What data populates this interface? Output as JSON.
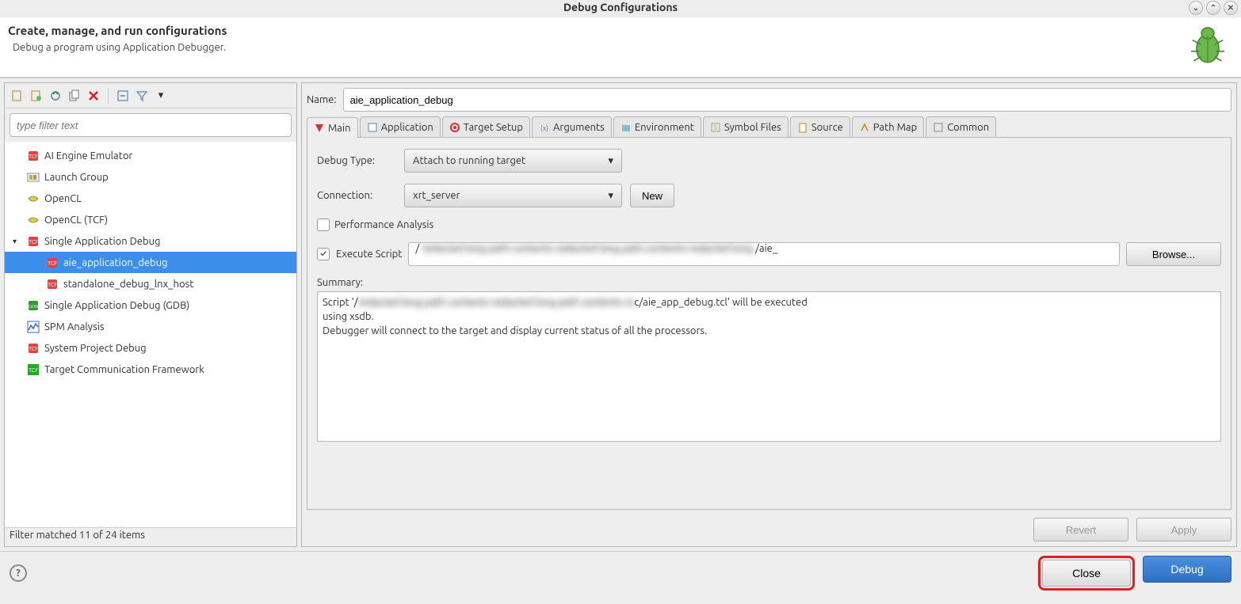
{
  "window": {
    "title": "Debug Configurations"
  },
  "header": {
    "title": "Create, manage, and run configurations",
    "subtitle": "Debug a program using Application Debugger."
  },
  "left": {
    "filter_placeholder": "type filter text",
    "status": "Filter matched 11 of 24 items",
    "tree": [
      {
        "label": "AI Engine Emulator",
        "icon": "tcf-icon"
      },
      {
        "label": "Launch Group",
        "icon": "launch-group-icon"
      },
      {
        "label": "OpenCL",
        "icon": "opencl-icon"
      },
      {
        "label": "OpenCL (TCF)",
        "icon": "opencl-icon"
      },
      {
        "label": "Single Application Debug",
        "icon": "tcf-icon",
        "expanded": true,
        "children": [
          {
            "label": "aie_application_debug",
            "icon": "tcf-icon",
            "selected": true
          },
          {
            "label": "standalone_debug_lnx_host",
            "icon": "tcf-icon"
          }
        ]
      },
      {
        "label": "Single Application Debug (GDB)",
        "icon": "gdb-icon"
      },
      {
        "label": "SPM Analysis",
        "icon": "spm-icon"
      },
      {
        "label": "System Project Debug",
        "icon": "tcf-icon"
      },
      {
        "label": "Target Communication Framework",
        "icon": "tcf-green-icon"
      }
    ]
  },
  "right": {
    "name_label": "Name:",
    "name_value": "aie_application_debug",
    "tabs": [
      {
        "label": "Main",
        "active": true
      },
      {
        "label": "Application"
      },
      {
        "label": "Target Setup"
      },
      {
        "label": "Arguments"
      },
      {
        "label": "Environment"
      },
      {
        "label": "Symbol Files"
      },
      {
        "label": "Source"
      },
      {
        "label": "Path Map"
      },
      {
        "label": "Common"
      }
    ],
    "debug_type_label": "Debug Type:",
    "debug_type_value": "Attach to running target",
    "connection_label": "Connection:",
    "connection_value": "xrt_server",
    "new_button": "New",
    "perf_analysis_label": "Performance Analysis",
    "execute_script_label": "Execute Script",
    "script_path_prefix": "/",
    "script_path_suffix": "/aie_",
    "browse_button": "Browse...",
    "summary_label": "Summary:",
    "summary_line1a": "Script '/",
    "summary_line1b": "c/aie_app_debug.tcl' will be executed",
    "summary_line2": "using xsdb.",
    "summary_line3": "Debugger will connect to the target and display current status of all the processors.",
    "revert_button": "Revert",
    "apply_button": "Apply"
  },
  "bottom": {
    "close_button": "Close",
    "debug_button": "Debug"
  }
}
